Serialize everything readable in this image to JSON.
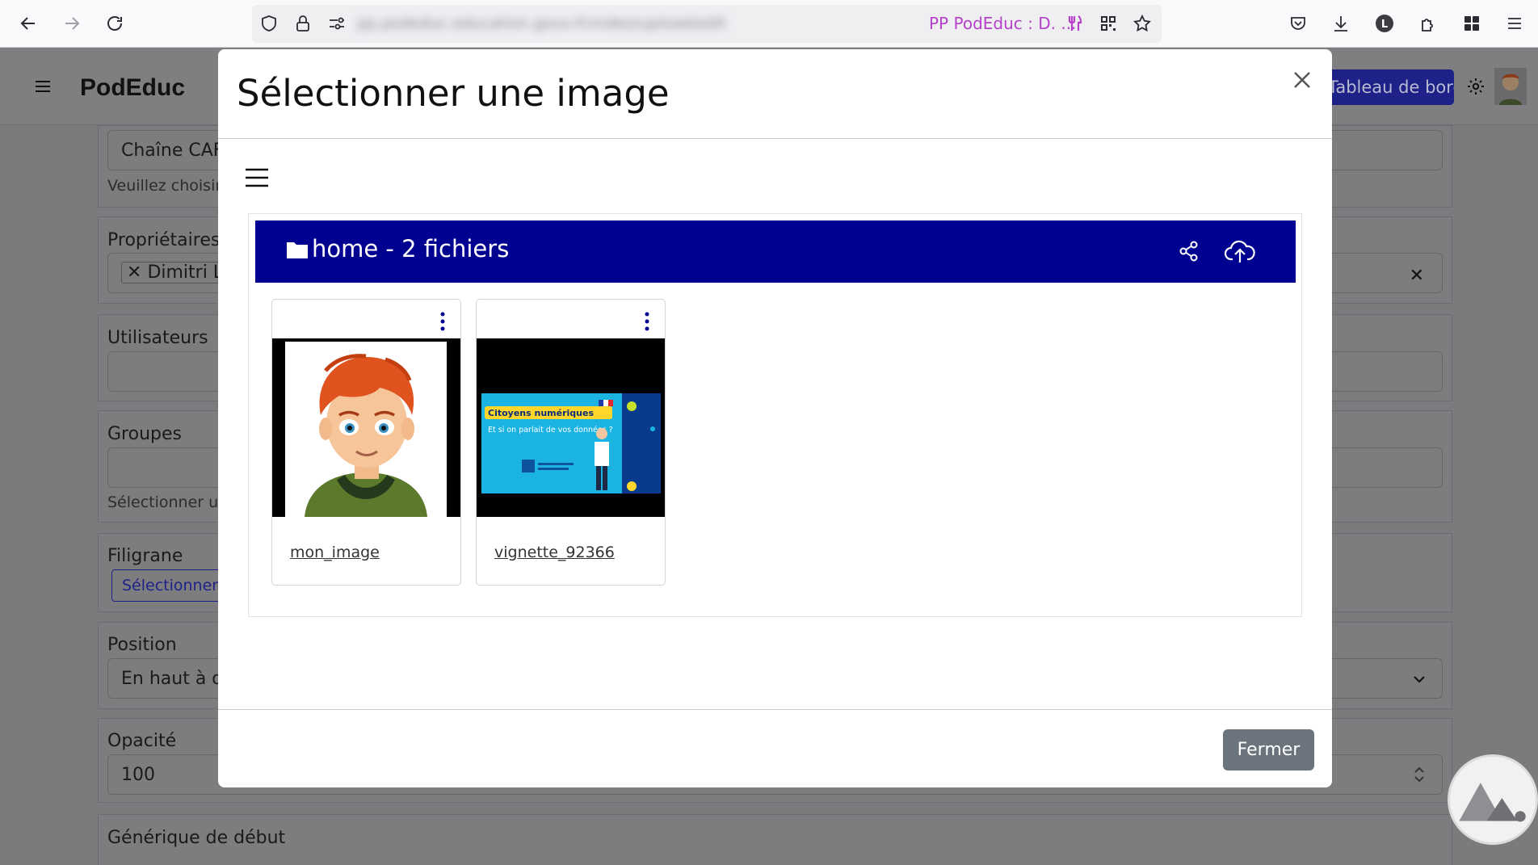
{
  "browser": {
    "url": "pp.podeduc.education.gouv.fr/video/upload/edit",
    "tab_title": "PP PodEduc : D. ..."
  },
  "app": {
    "name": "PodEduc",
    "dashboard_label": "Tableau de bord"
  },
  "form": {
    "channel_value": "Chaîne CAF",
    "channel_help": "Veuillez choisir",
    "owners_label": "Propriétaires",
    "owner_tag": "Dimitri Le",
    "users_label": "Utilisateurs",
    "groups_label": "Groupes",
    "groups_help": "Sélectionner un",
    "watermark_label": "Filigrane",
    "watermark_button": "Sélectionner",
    "position_label": "Position",
    "position_value": "En haut à d",
    "opacity_label": "Opacité",
    "opacity_value": "100",
    "intro_label": "Générique de début"
  },
  "modal": {
    "title": "Sélectionner une image",
    "folder_name": "home - 2 fichiers",
    "files": [
      {
        "name": "mon_image"
      },
      {
        "name": "vignette_92366",
        "thumb_title": "Citoyens numériques",
        "thumb_subtitle": "Et si on parlait de vos données ?"
      }
    ],
    "close_button": "Fermer"
  },
  "colors": {
    "folder_bar": "#000091",
    "dashboard_button": "#1d2188",
    "close_button": "#6b747c",
    "tab_title": "#b540c9"
  },
  "icons": [
    "back-icon",
    "forward-icon",
    "reload-icon",
    "shield-icon",
    "lock-icon",
    "permissions-icon",
    "fork-knife-icon",
    "qr-icon",
    "star-icon",
    "pocket-icon",
    "download-icon",
    "account-icon",
    "extensions-icon",
    "apps-icon",
    "menu-icon",
    "close-icon",
    "hamburger-icon",
    "folder-icon",
    "share-icon",
    "cloud-upload-icon",
    "kebab-icon",
    "gear-icon"
  ]
}
